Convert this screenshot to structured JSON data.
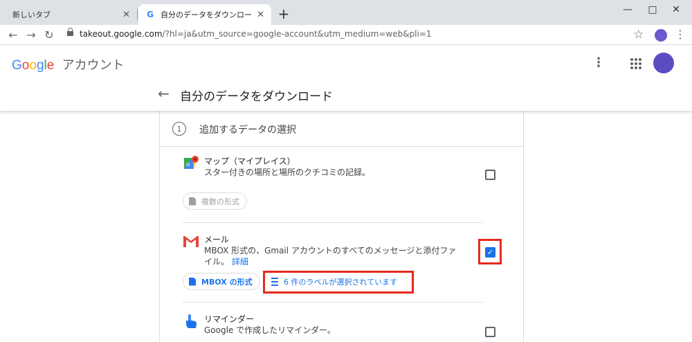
{
  "browser": {
    "tabs": [
      {
        "title": "新しいタブ",
        "active": false
      },
      {
        "title": "自分のデータをダウンロード",
        "active": true
      }
    ],
    "url_host": "takeout.google.com",
    "url_path": "/?hl=ja&utm_source=google-account&utm_medium=web&pli=1"
  },
  "header": {
    "logo_letters": [
      "G",
      "o",
      "o",
      "g",
      "l",
      "e"
    ],
    "account_label": "アカウント",
    "page_title": "自分のデータをダウンロード"
  },
  "step": {
    "number": "1",
    "label": "追加するデータの選択"
  },
  "products": [
    {
      "name": "マップ（マイプレイス）",
      "description": "スター付きの場所と場所のクチコミの記録。",
      "checked": false,
      "format_chip": "複数の形式"
    },
    {
      "name": "メール",
      "description": "MBOX 形式の、Gmail アカウントのすべてのメッセージと添付ファイル。",
      "more_link": "詳細",
      "checked": true,
      "format_chip": "MBOX の形式",
      "labels_chip": "6 件のラベルが選択されています"
    },
    {
      "name": "リマインダー",
      "description": "Google で作成したリマインダー。",
      "checked": false
    }
  ],
  "colors": {
    "accent": "#1a73e8",
    "highlight": "#e8281c"
  }
}
